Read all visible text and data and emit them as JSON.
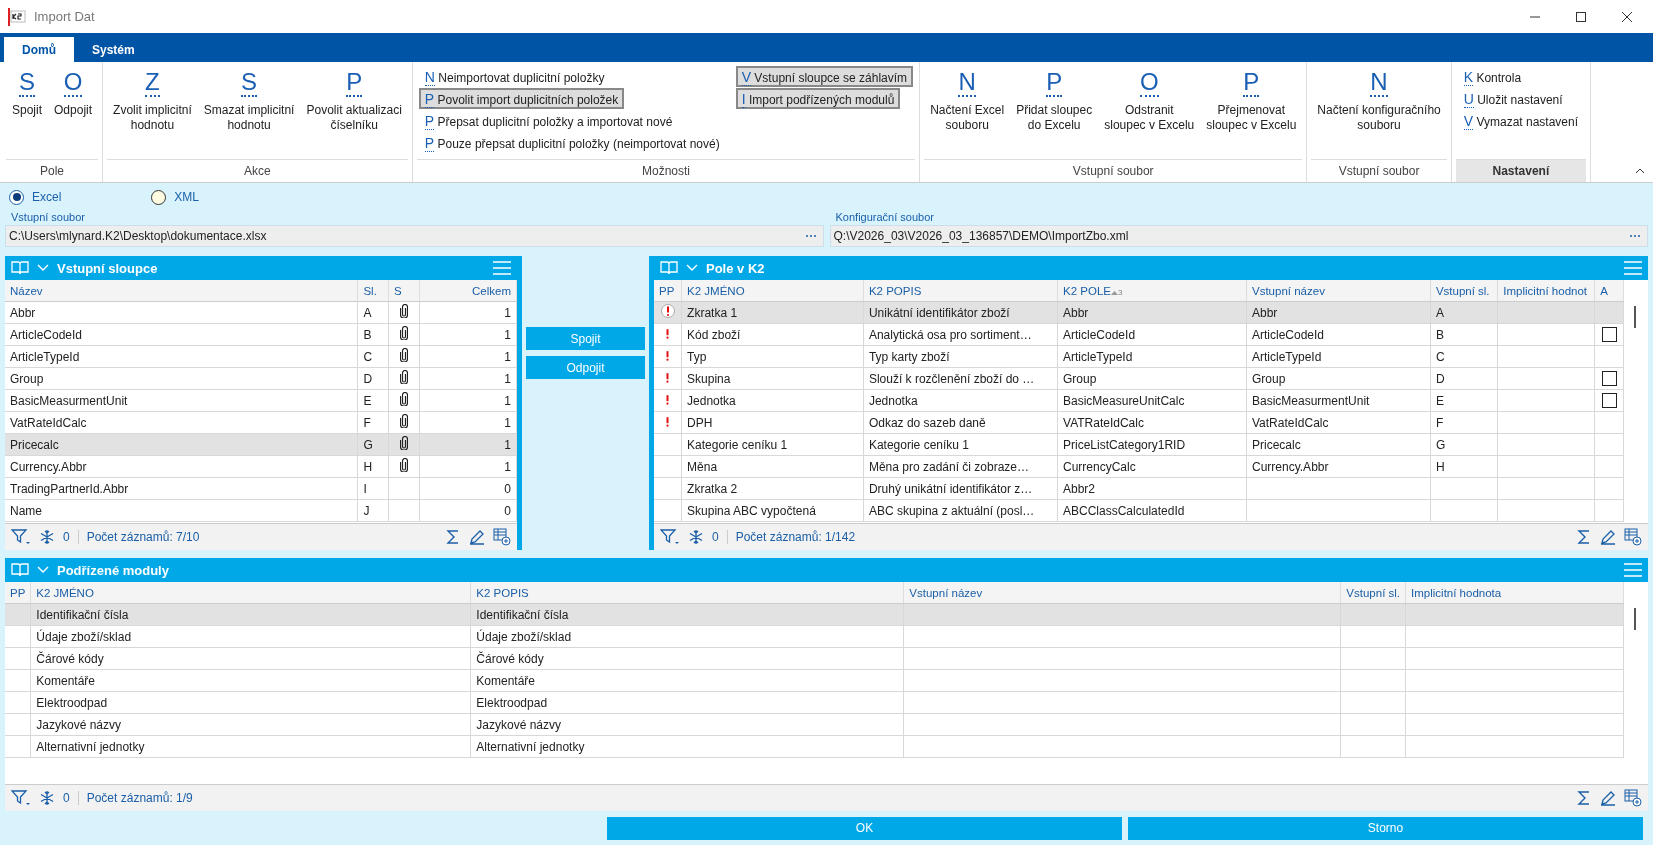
{
  "window": {
    "title": "Import Dat"
  },
  "tabs": [
    {
      "label": "Domů",
      "selected": true
    },
    {
      "label": "Systém",
      "selected": false
    }
  ],
  "ribbon_groups": [
    {
      "label": "Pole",
      "highlighted": false,
      "items": [
        {
          "kind": "large",
          "key": "S",
          "label": "Spojit",
          "pressed": false
        },
        {
          "kind": "large",
          "key": "O",
          "label": "Odpojit",
          "pressed": false
        }
      ]
    },
    {
      "label": "Akce",
      "highlighted": false,
      "items": [
        {
          "kind": "large",
          "key": "Z",
          "label": "Zvolit implicitní\nhodnotu",
          "pressed": false
        },
        {
          "kind": "large",
          "key": "S",
          "label": "Smazat implicitní\nhodnotu",
          "pressed": false
        },
        {
          "kind": "large",
          "key": "P",
          "label": "Povolit aktualizaci\nčíselníku",
          "pressed": false
        }
      ]
    },
    {
      "label": "Možnosti",
      "highlighted": false,
      "items": [
        {
          "kind": "small",
          "key": "N",
          "label": "Neimportovat duplicitní položky",
          "pressed": false
        },
        {
          "kind": "small",
          "key": "P",
          "label": "Povolit import duplicitních položek",
          "pressed": true
        },
        {
          "kind": "small",
          "key": "P",
          "label": "Přepsat duplicitní položky a importovat nové",
          "pressed": false
        },
        {
          "kind": "small",
          "key": "P",
          "label": "Pouze přepsat duplicitní položky (neimportovat nové)",
          "pressed": false
        },
        {
          "kind": "small",
          "key": "V",
          "label": "Vstupní sloupce se záhlavím",
          "pressed": true
        },
        {
          "kind": "small",
          "key": "I",
          "label": "Import podřízených modulů",
          "pressed": true
        }
      ]
    },
    {
      "label": "Vstupní soubor",
      "highlighted": false,
      "items": [
        {
          "kind": "large",
          "key": "N",
          "label": "Načtení Excel\nsouboru",
          "pressed": false
        },
        {
          "kind": "large",
          "key": "P",
          "label": "Přidat sloupec\ndo Excelu",
          "pressed": false
        },
        {
          "kind": "large",
          "key": "O",
          "label": "Odstranit\nsloupec v Excelu",
          "pressed": false
        },
        {
          "kind": "large",
          "key": "P",
          "label": "Přejmenovat\nsloupec v Excelu",
          "pressed": false
        }
      ]
    },
    {
      "label": "Vstupní soubor",
      "highlighted": false,
      "items": [
        {
          "kind": "large",
          "key": "N",
          "label": "Načtení konfiguračního\nsouboru",
          "pressed": false
        }
      ]
    },
    {
      "label": "Nastavení",
      "highlighted": true,
      "items": [
        {
          "kind": "small",
          "key": "K",
          "label": "Kontrola",
          "pressed": false
        },
        {
          "kind": "small",
          "key": "U",
          "label": "Uložit nastavení",
          "pressed": false
        },
        {
          "kind": "small",
          "key": "V",
          "label": "Vymazat nastavení",
          "pressed": false
        }
      ]
    }
  ],
  "source_types": [
    {
      "label": "Excel",
      "selected": true
    },
    {
      "label": "XML",
      "selected": false
    }
  ],
  "input_file": {
    "label": "Vstupní soubor",
    "value": "C:\\Users\\mlynard.K2\\Desktop\\dokumentace.xlsx"
  },
  "config_file": {
    "label": "Konfigurační soubor",
    "value": "Q:\\V2026_03\\V2026_03_136857\\DEMO\\ImportZbo.xml"
  },
  "input_columns": {
    "title": "Vstupní sloupce",
    "columns": [
      "Název",
      "Sl.",
      "S",
      "Celkem"
    ],
    "rows": [
      {
        "name": "Abbr",
        "col": "A",
        "attached": true,
        "total": "1",
        "selected": false
      },
      {
        "name": "ArticleCodeId",
        "col": "B",
        "attached": true,
        "total": "1",
        "selected": false
      },
      {
        "name": "ArticleTypeId",
        "col": "C",
        "attached": true,
        "total": "1",
        "selected": false
      },
      {
        "name": "Group",
        "col": "D",
        "attached": true,
        "total": "1",
        "selected": false
      },
      {
        "name": "BasicMeasurmentUnit",
        "col": "E",
        "attached": true,
        "total": "1",
        "selected": false
      },
      {
        "name": "VatRateIdCalc",
        "col": "F",
        "attached": true,
        "total": "1",
        "selected": false
      },
      {
        "name": "Pricecalc",
        "col": "G",
        "attached": true,
        "total": "1",
        "selected": true
      },
      {
        "name": "Currency.Abbr",
        "col": "H",
        "attached": true,
        "total": "1",
        "selected": false
      },
      {
        "name": "TradingPartnerId.Abbr",
        "col": "I",
        "attached": false,
        "total": "0",
        "selected": false
      },
      {
        "name": "Name",
        "col": "J",
        "attached": false,
        "total": "0",
        "selected": false
      }
    ],
    "filter_count": "0",
    "record_count": "Počet záznamů: 7/10"
  },
  "link_buttons": [
    "Spojit",
    "Odpojit"
  ],
  "k2_fields": {
    "title": "Pole v K2",
    "mark_column": "PP",
    "columns": [
      {
        "label": "K2 JMÉNO",
        "sorted": false
      },
      {
        "label": "K2 POPIS",
        "sorted": false
      },
      {
        "label": "K2 POLE",
        "sorted": true,
        "sort_order": "3"
      },
      {
        "label": "Vstupní název",
        "sorted": false
      },
      {
        "label": "Vstupní sl.",
        "sorted": false
      },
      {
        "label": "Implicitní hodnot",
        "sorted": false
      },
      {
        "label": "A",
        "sorted": false
      }
    ],
    "rows": [
      {
        "required": true,
        "selected": true,
        "cells": [
          "Zkratka 1",
          "Unikátní identifikátor zboží",
          "Abbr",
          "Abbr",
          "A",
          ""
        ]
      },
      {
        "required": true,
        "selected": false,
        "checked": false,
        "cells": [
          "Kód zboží",
          "Analytická osa pro sortiment…",
          "ArticleCodeId",
          "ArticleCodeId",
          "B",
          ""
        ]
      },
      {
        "required": true,
        "selected": false,
        "cells": [
          "Typ",
          "Typ karty zboží",
          "ArticleTypeId",
          "ArticleTypeId",
          "C",
          ""
        ]
      },
      {
        "required": true,
        "selected": false,
        "checked": false,
        "cells": [
          "Skupina",
          "Slouží k rozčlenění zboží do …",
          "Group",
          "Group",
          "D",
          ""
        ]
      },
      {
        "required": true,
        "selected": false,
        "checked": false,
        "cells": [
          "Jednotka",
          "Jednotka",
          "BasicMeasureUnitCalc",
          "BasicMeasurmentUnit",
          "E",
          ""
        ]
      },
      {
        "required": true,
        "selected": false,
        "cells": [
          "DPH",
          "Odkaz do sazeb daně",
          "VATRateIdCalc",
          "VatRateIdCalc",
          "F",
          ""
        ]
      },
      {
        "required": false,
        "selected": false,
        "cells": [
          "Kategorie ceníku 1",
          "Kategorie ceníku 1",
          "PriceListCategory1RID",
          "Pricecalc",
          "G",
          ""
        ]
      },
      {
        "required": false,
        "selected": false,
        "cells": [
          "Měna",
          "Měna pro zadání či zobraze…",
          "CurrencyCalc",
          "Currency.Abbr",
          "H",
          ""
        ]
      },
      {
        "required": false,
        "selected": false,
        "cells": [
          "Zkratka 2",
          "Druhý unikátní identifikátor z…",
          "Abbr2",
          "",
          "",
          ""
        ]
      },
      {
        "required": false,
        "selected": false,
        "cells": [
          "Skupina ABC vypočtená",
          "ABC skupina z aktuální (posl…",
          "ABCClassCalculatedId",
          "",
          "",
          ""
        ]
      }
    ],
    "filter_count": "0",
    "record_count": "Počet záznamů: 1/142"
  },
  "sub_modules": {
    "title": "Podřízené moduly",
    "mark_column": "PP",
    "columns": [
      "K2 JMÉNO",
      "K2 POPIS",
      "Vstupní název",
      "Vstupní sl.",
      "Implicitní hodnota"
    ],
    "rows": [
      {
        "selected": true,
        "cells": [
          "Identifikační čísla",
          "Identifikační čísla"
        ]
      },
      {
        "selected": false,
        "cells": [
          "Údaje zboží/sklad",
          "Údaje zboží/sklad"
        ]
      },
      {
        "selected": false,
        "cells": [
          "Čárové kódy",
          "Čárové kódy"
        ]
      },
      {
        "selected": false,
        "cells": [
          "Komentáře",
          "Komentáře"
        ]
      },
      {
        "selected": false,
        "cells": [
          "Elektroodpad",
          "Elektroodpad"
        ]
      },
      {
        "selected": false,
        "cells": [
          "Jazykové názvy",
          "Jazykové názvy"
        ]
      },
      {
        "selected": false,
        "cells": [
          "Alternativní jednotky",
          "Alternativní jednotky"
        ]
      }
    ],
    "filter_count": "0",
    "record_count": "Počet záznamů: 1/9"
  },
  "dialog_buttons": [
    "OK",
    "Storno"
  ]
}
